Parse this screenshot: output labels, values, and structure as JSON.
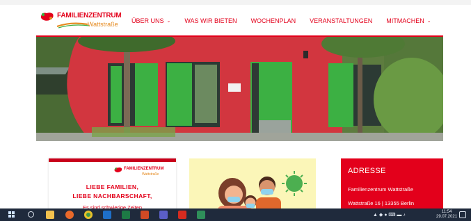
{
  "logo": {
    "line1": "FAMILIENZENTRUM",
    "line2": "Wattstraße"
  },
  "nav": {
    "items": [
      {
        "label": "ÜBER UNS",
        "has_dropdown": true
      },
      {
        "label": "WAS WIR BIETEN",
        "has_dropdown": false
      },
      {
        "label": "WOCHENPLAN",
        "has_dropdown": false
      },
      {
        "label": "VERANSTALTUNGEN",
        "has_dropdown": false
      },
      {
        "label": "MITMACHEN",
        "has_dropdown": true
      }
    ],
    "chevron": "⌄"
  },
  "notice_card": {
    "logo_line1": "FAMILIENZENTRUM",
    "logo_line2": "Wattstraße",
    "heading_line1": "LIEBE FAMILIEN,",
    "heading_line2": "LIEBE NACHBARSCHAFT,",
    "subtext": "Es sind schwierige Zeiten"
  },
  "address_card": {
    "title": "ADRESSE",
    "line1": "Familienzentrum Wattstraße",
    "line2": "Wattstraße 16 | 13355 Berlin"
  },
  "taskbar": {
    "icons": [
      "windows-start-icon",
      "search-icon",
      "file-explorer-icon",
      "firefox-icon",
      "chrome-icon",
      "outlook-icon",
      "excel-icon",
      "powerpoint-icon",
      "teams-icon",
      "acrobat-icon",
      "project-icon"
    ],
    "time": "11:54",
    "date": "29.07.2021"
  },
  "colors": {
    "brand_red": "#e3001b",
    "brand_orange": "#e58a1f",
    "taskbar": "#1f2a3c",
    "building_red": "#d2363f",
    "door_green": "#3cb043"
  }
}
